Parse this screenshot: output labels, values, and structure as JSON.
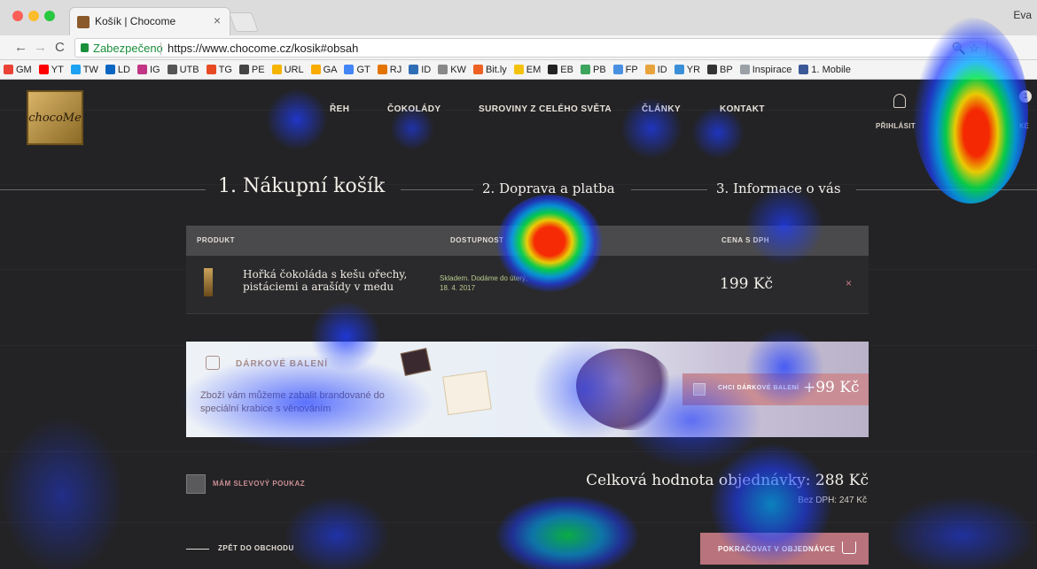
{
  "browser": {
    "tab_title": "Košík | Chocome",
    "tab_close": "×",
    "profile_name": "Eva",
    "secure_label": "Zabezpečeno",
    "url": "https://www.chocome.cz/kosik#obsah",
    "omnibox_icons": "🔍 ☆",
    "bookmarks": [
      {
        "label": "GM",
        "color": "#ea4335"
      },
      {
        "label": "YT",
        "color": "#ff0000"
      },
      {
        "label": "TW",
        "color": "#1da1f2"
      },
      {
        "label": "LD",
        "color": "#0a66c2"
      },
      {
        "label": "IG",
        "color": "#c13584"
      },
      {
        "label": "UTB",
        "color": "#555555"
      },
      {
        "label": "TG",
        "color": "#e84a23"
      },
      {
        "label": "PE",
        "color": "#444444"
      },
      {
        "label": "URL",
        "color": "#f4b400"
      },
      {
        "label": "GA",
        "color": "#f9ab00"
      },
      {
        "label": "GT",
        "color": "#4285f4"
      },
      {
        "label": "RJ",
        "color": "#e37400"
      },
      {
        "label": "ID",
        "color": "#2f6db5"
      },
      {
        "label": "KW",
        "color": "#888888"
      },
      {
        "label": "Bit.ly",
        "color": "#ee6123"
      },
      {
        "label": "EM",
        "color": "#f4c20d"
      },
      {
        "label": "EB",
        "color": "#222222"
      },
      {
        "label": "PB",
        "color": "#3ca45c"
      },
      {
        "label": "FP",
        "color": "#4a90e2"
      },
      {
        "label": "ID",
        "color": "#e8a33d"
      },
      {
        "label": "YR",
        "color": "#3b8fd8"
      },
      {
        "label": "BP",
        "color": "#333333"
      },
      {
        "label": "Inspirace",
        "color": "#9aa0a6"
      },
      {
        "label": "1. Mobile",
        "color": "#3b5998"
      }
    ]
  },
  "site": {
    "logo_text": "chocoMe",
    "nav": [
      {
        "label": "ŘEH"
      },
      {
        "label": "ČOKOLÁDY"
      },
      {
        "label": "SUROVINY Z CELÉHO SVĚTA"
      },
      {
        "label": "ČLÁNKY"
      },
      {
        "label": "KONTAKT"
      }
    ],
    "login_label": "PŘIHLÁSIT",
    "cart_count": "1",
    "cart_label": "KÉ",
    "steps": [
      "1. Nákupní košík",
      "2. Doprava a platba",
      "3. Informace o vás"
    ],
    "table": {
      "headers": {
        "product": "PRODUKT",
        "availability": "DOSTUPNOST",
        "price": "CENA S DPH"
      },
      "row": {
        "name": "Hořká čokoláda s kešu ořechy, pistáciemi a arašídy v medu",
        "availability": "Skladem. Dodáme do úterý, 18. 4. 2017",
        "price": "199 Kč",
        "remove": "×"
      }
    },
    "gift": {
      "title": "DÁRKOVÉ BALENÍ",
      "text": "Zboží vám můžeme zabalit brandované do speciální krabice s věnováním",
      "button_label": "CHCI DÁRKOVÉ BALENÍ",
      "button_price": "+99 Kč"
    },
    "voucher_label": "MÁM SLEVOVÝ POUKAZ",
    "total": "Celková hodnota objednávky: 288 Kč",
    "total_nodph": "Bez DPH: 247 Kč",
    "back_label": "ZPĚT DO OBCHODU",
    "continue_label": "POKRAČOVAT V OBJEDNÁVCE"
  },
  "colors": {
    "accent": "#c98e95",
    "background": "#232325",
    "heat_low": "#1e3cff",
    "heat_high": "#ff2a00"
  }
}
